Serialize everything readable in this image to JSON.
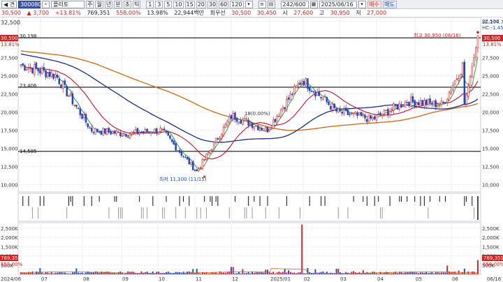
{
  "toolbar": {
    "code_value": "300080",
    "name_value": "플리토",
    "period_buttons": [
      "주",
      "월",
      "년",
      "분",
      "초",
      "틱"
    ],
    "minute_buttons": [
      "1",
      "3",
      "5",
      "10",
      "15",
      "20",
      "30",
      "60",
      "120"
    ],
    "count_value": "242/600",
    "date_value": "2025/06/16",
    "buy_label": "매수",
    "sell_label": "매도",
    "prev_tag": "◀ 견"
  },
  "infobar": {
    "price": "30,500",
    "change": "▲ 3,700",
    "change_pct": "+13.81%",
    "volume": "769,351",
    "volume_ratio": "558.00%",
    "turnover_pct": "13.98%",
    "trade_value": "22,944백만",
    "best_ask_label": "최우선",
    "best_ask": "30,500",
    "best_bid": "30,450",
    "open_label": "시",
    "open": "27,600",
    "high_label": "고",
    "high": "30,950",
    "low_label": "저",
    "low": "27,000"
  },
  "price_panel": {
    "y_ticks": [
      "32,500",
      "30,000",
      "27,500",
      "25,000",
      "22,500",
      "20,000",
      "17,500",
      "15,000",
      "12,500",
      "10,000"
    ],
    "right_top_label": "LC:174.77",
    "right_top_label2": "HC:-1.45",
    "current_tag": "30,500",
    "current_pct_tag": "13.81%",
    "h_lines": [
      "30,198",
      "23,406",
      "14,585"
    ],
    "annotation_high": "최고 30,950 (06/16)",
    "annotation_low": "최저 11,100 (11/15)",
    "annotation_mid": "18(0.00%)"
  },
  "volume_panel": {
    "y_ticks": [
      "2,500K",
      "2,000K",
      "1,500K",
      "1,000K",
      "500K"
    ],
    "current_tag": "769,351",
    "current_pct_tag": "558.00%"
  },
  "x_axis": {
    "labels": [
      "2024/06",
      "07",
      "08",
      "09",
      "10",
      "11",
      "12",
      "2025/01",
      "02",
      "03",
      "04",
      "05",
      "06",
      "06/16"
    ]
  },
  "colors": {
    "up": "#d32020",
    "down": "#1d47c8",
    "ma5": "#2e8b2e",
    "ma20": "#c0142a",
    "ma60": "#1a2b8c",
    "ma120": "#cc6a10",
    "hline": "#111111"
  },
  "chart_data": {
    "type": "candlestick",
    "series_price": [
      {
        "x": "2024/06",
        "close": 26500
      },
      {
        "x": "07",
        "close": 25000
      },
      {
        "x": "08",
        "close": 17500
      },
      {
        "x": "09",
        "close": 17000
      },
      {
        "x": "10",
        "close": 17500
      },
      {
        "x": "11",
        "close": 11800
      },
      {
        "x": "12",
        "close": 19500
      },
      {
        "x": "2025/01",
        "close": 17500
      },
      {
        "x": "02",
        "close": 24500
      },
      {
        "x": "03",
        "close": 20000
      },
      {
        "x": "04",
        "close": 19000
      },
      {
        "x": "05",
        "close": 21500
      },
      {
        "x": "06",
        "close": 21000
      },
      {
        "x": "06/16",
        "close": 30500
      }
    ],
    "series_volume": [
      {
        "x": "2024/06",
        "value": 120000
      },
      {
        "x": "07",
        "value": 90000
      },
      {
        "x": "08",
        "value": 110000
      },
      {
        "x": "09",
        "value": 60000
      },
      {
        "x": "10",
        "value": 70000
      },
      {
        "x": "11",
        "value": 300000
      },
      {
        "x": "12",
        "value": 400000
      },
      {
        "x": "2025/01",
        "value": 250000
      },
      {
        "x": "02",
        "value": 2700000
      },
      {
        "x": "03",
        "value": 300000
      },
      {
        "x": "04",
        "value": 150000
      },
      {
        "x": "05",
        "value": 120000
      },
      {
        "x": "06",
        "value": 100000
      },
      {
        "x": "06/16",
        "value": 769351
      }
    ],
    "ylim_price": [
      9000,
      33000
    ],
    "ylim_volume": [
      0,
      2800000
    ]
  }
}
